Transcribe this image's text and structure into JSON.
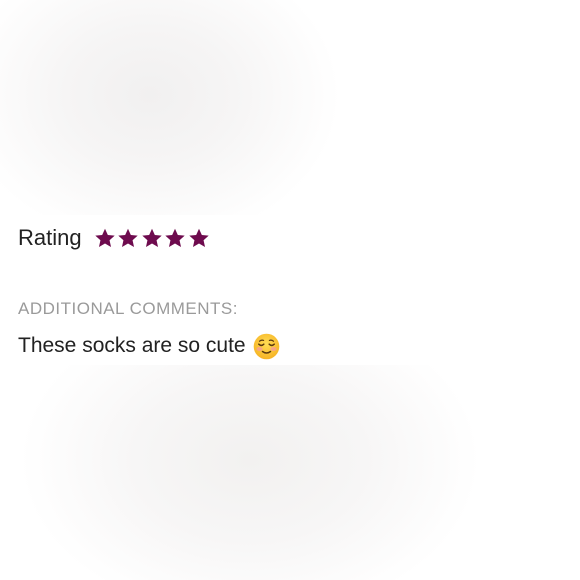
{
  "rating": {
    "label": "Rating",
    "value": 5,
    "max": 5,
    "star_color": "#6e0b4e",
    "star_icon": "star-icon"
  },
  "comments": {
    "heading": "ADDITIONAL COMMENTS:",
    "text": "These socks are so cute",
    "emoji_icon": "smiling-face-icon"
  },
  "colors": {
    "label_text": "#222222",
    "heading_text": "#9a9a9a",
    "background": "#ffffff"
  }
}
